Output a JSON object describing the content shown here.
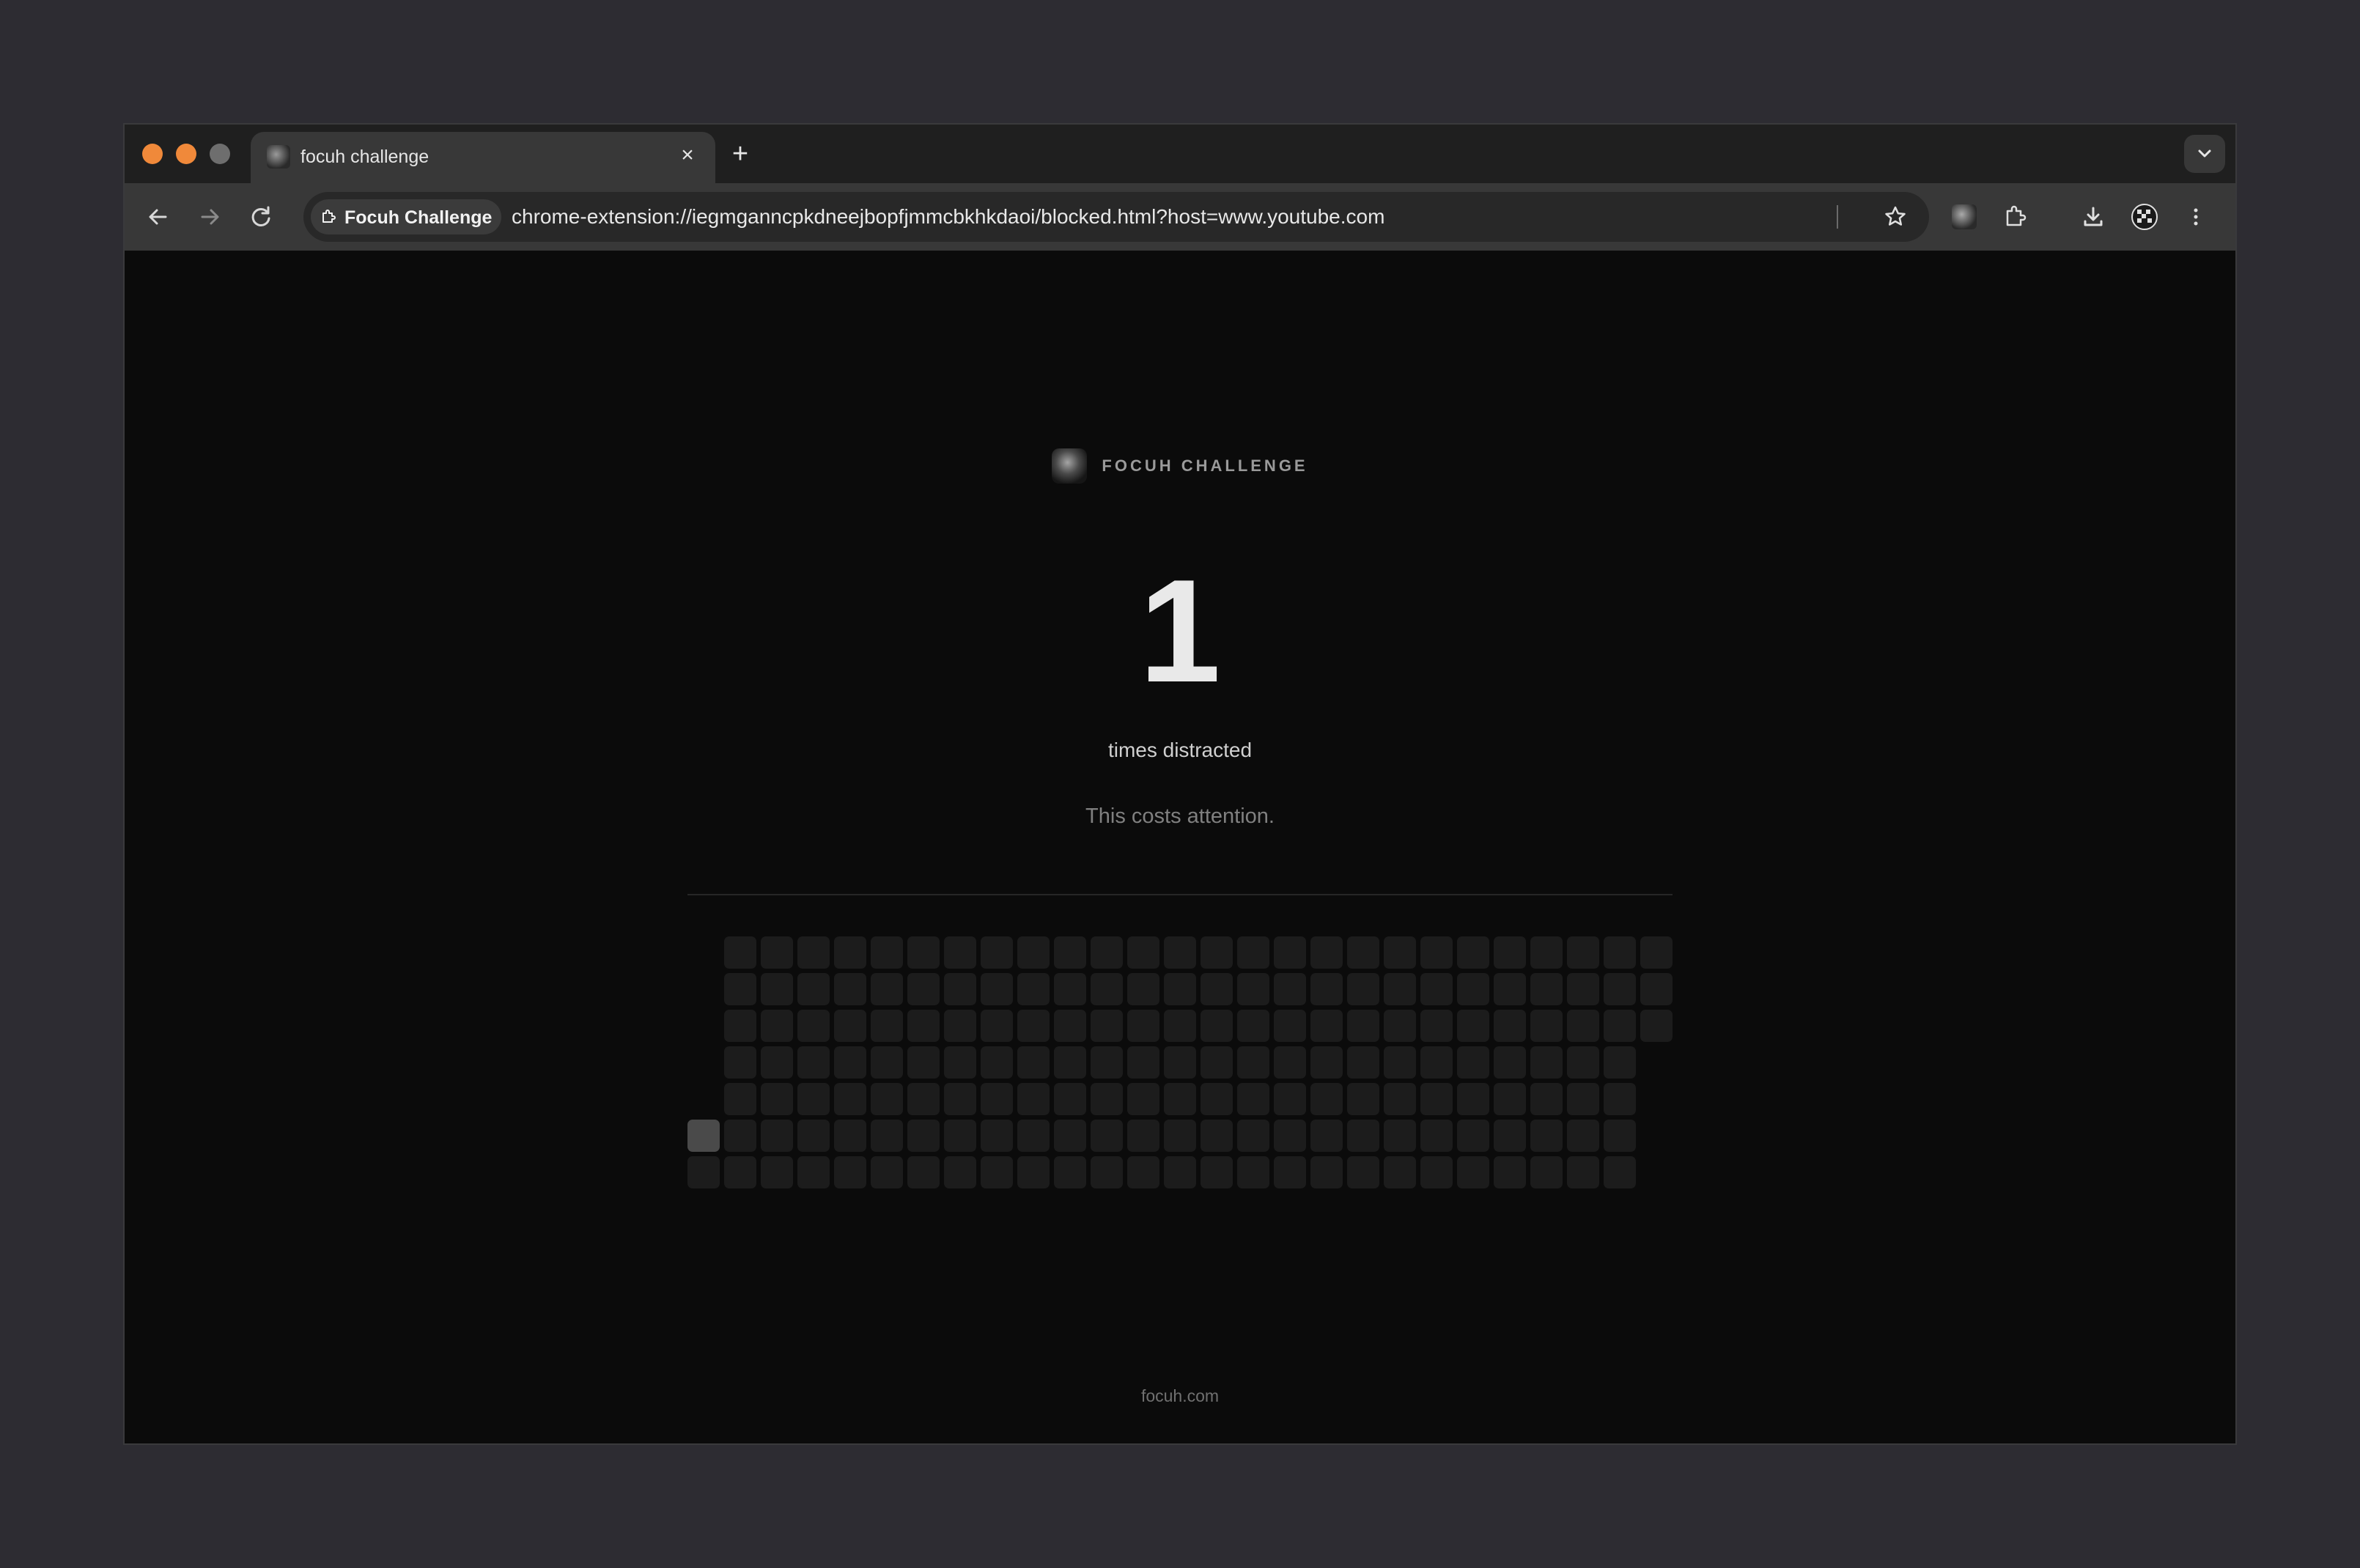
{
  "browser": {
    "tab": {
      "title": "focuh challenge",
      "favicon": "focuh-logo-icon",
      "close_label": "×"
    },
    "new_tab_label": "+",
    "omnibox": {
      "chip_label": "Focuh Challenge",
      "url": "chrome-extension://iegmganncpkdneejbopfjmmcbkhkdaoi/blocked.html?host=www.youtube.com"
    },
    "icons": {
      "back": "back-arrow-icon",
      "forward": "forward-arrow-icon",
      "reload": "reload-icon",
      "bookmark": "star-icon",
      "extension_focuh": "focuh-extension-icon",
      "extensions": "puzzle-icon",
      "downloads": "download-icon",
      "profile": "avatar-icon",
      "menu": "kebab-menu-icon"
    }
  },
  "page": {
    "brand": "FOCUH CHALLENGE",
    "count": "1",
    "count_label": "times distracted",
    "note": "This costs attention.",
    "footer": "focuh.com"
  },
  "grid": {
    "columns": 27,
    "rows": 7,
    "active_cell": {
      "row": 5,
      "col": 0
    },
    "row_ranges": [
      [
        1,
        26
      ],
      [
        1,
        26
      ],
      [
        1,
        26
      ],
      [
        1,
        25
      ],
      [
        1,
        25
      ],
      [
        0,
        25
      ],
      [
        0,
        25
      ]
    ]
  },
  "colors": {
    "accent_orange": "#f0893a",
    "page_bg": "#0b0b0b",
    "cell": "#1c1c1c",
    "cell_active": "#4a4a4a"
  }
}
